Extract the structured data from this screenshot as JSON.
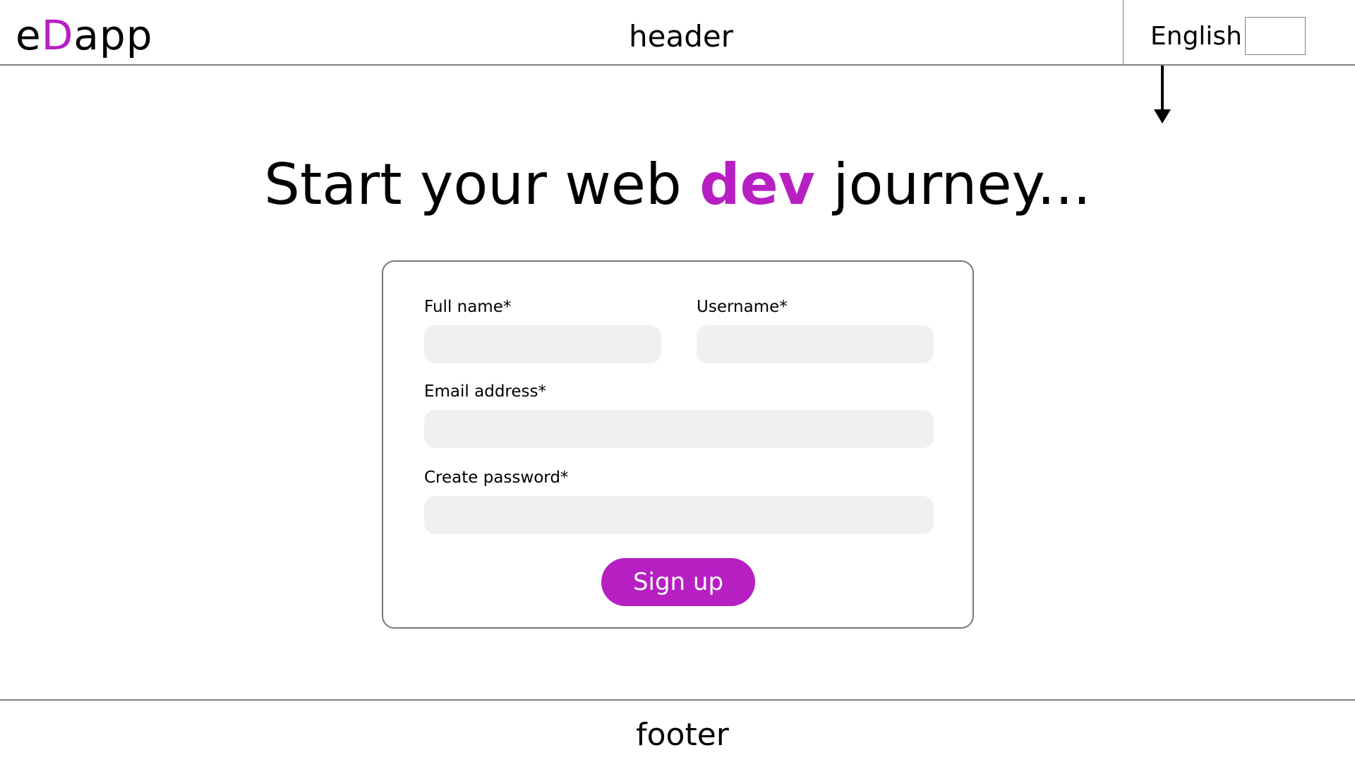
{
  "header": {
    "logo_prefix": "e",
    "logo_accent": "D",
    "logo_suffix": "app",
    "title": "header",
    "language_label": "English",
    "language_select_value": ""
  },
  "headline": {
    "prefix": "Start your web",
    "accent": "dev",
    "suffix": "journey..."
  },
  "form": {
    "fullname_label": "Full name*",
    "fullname_value": "",
    "username_label": "Username*",
    "username_value": "",
    "email_label": "Email address*",
    "email_value": "",
    "password_label": "Create password*",
    "password_value": "",
    "submit_label": "Sign up"
  },
  "footer": {
    "text": "footer"
  },
  "colors": {
    "accent": "#b71fc3",
    "input_background": "#f0f0f0",
    "border": "#808080"
  },
  "icons": {
    "language_arrow": "arrow-down-icon"
  }
}
